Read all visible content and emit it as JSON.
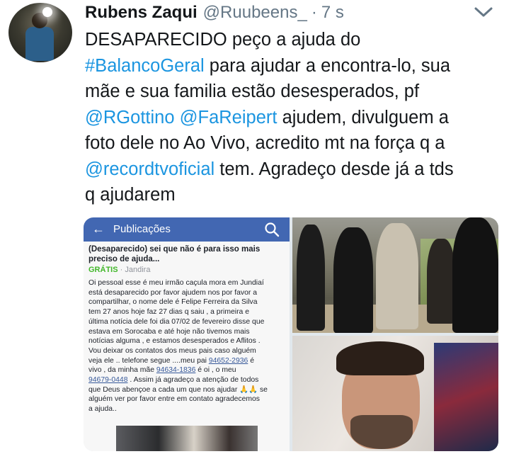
{
  "tweet": {
    "author_name": "Rubens Zaqui",
    "handle": "@Ruubeens_",
    "separator": "·",
    "time": "7 s",
    "text_lines": [
      [
        {
          "t": "DESAPARECIDO peço a ajuda do",
          "link": false
        }
      ],
      [
        {
          "t": "#BalancoGeral",
          "link": true
        },
        {
          "t": " para ajudar a encontra-lo, sua",
          "link": false
        }
      ],
      [
        {
          "t": "mãe e sua familia estão desesperados, pf",
          "link": false
        }
      ],
      [
        {
          "t": "@RGottino",
          "link": true
        },
        {
          "t": " ",
          "link": false
        },
        {
          "t": "@FaReipert",
          "link": true
        },
        {
          "t": " ajudem, divulguem a",
          "link": false
        }
      ],
      [
        {
          "t": "foto dele no Ao Vivo, acredito mt na força q a",
          "link": false
        }
      ],
      [
        {
          "t": "@recordtvoficial",
          "link": true
        },
        {
          "t": " tem. Agradeço desde já a tds",
          "link": false
        }
      ],
      [
        {
          "t": "q ajudarem",
          "link": false
        }
      ]
    ]
  },
  "screenshot": {
    "back_arrow": "←",
    "bar_title": "Publicações",
    "search_icon": "search-icon",
    "post_title": "(Desaparecido) sei que não é para isso mais preciso de ajuda...",
    "price": "GRÁTIS",
    "meta_separator": "·",
    "location": "Jandira",
    "body_lines": [
      [
        {
          "t": "Oi pessoal esse é meu irmão caçula mora em Jundiaí"
        }
      ],
      [
        {
          "t": "está desaparecido por favor ajudem nos por favor a"
        }
      ],
      [
        {
          "t": "compartilhar, o nome dele é Felipe Ferreira da Silva"
        }
      ],
      [
        {
          "t": "tem 27 anos hoje faz 27 dias q saiu , a primeira e"
        }
      ],
      [
        {
          "t": "última notícia dele foi dia 07/02 de fevereiro disse que"
        }
      ],
      [
        {
          "t": "estava em Sorocaba e até hoje não tivemos mais"
        }
      ],
      [
        {
          "t": "notícias alguma , e estamos desesperados e Aflitos ."
        }
      ],
      [
        {
          "t": "Vou deixar os contatos dos meus pais caso alguém"
        }
      ],
      [
        {
          "t": "veja ele .. telefone segue ....meu pai "
        },
        {
          "t": "94652-2936",
          "phone": true
        },
        {
          "t": " é"
        }
      ],
      [
        {
          "t": "vivo , da minha mãe "
        },
        {
          "t": "94634-1836",
          "phone": true
        },
        {
          "t": " é oi , o meu"
        }
      ],
      [
        {
          "t": "94679-0448",
          "phone": true
        },
        {
          "t": " . Assim já agradeço a atenção de todos"
        }
      ],
      [
        {
          "t": "que Deus abençoe a cada um que nos ajudar "
        },
        {
          "t": "🙏🙏",
          "emoji": true
        },
        {
          "t": " se"
        }
      ],
      [
        {
          "t": "alguém ver por favor entre em contato agradecemos"
        }
      ],
      [
        {
          "t": "a ajuda.."
        }
      ]
    ]
  },
  "colors": {
    "link": "#1b95e0",
    "facebook_bar": "#4267b2",
    "gratis": "#42b72a",
    "muted": "#657786"
  }
}
